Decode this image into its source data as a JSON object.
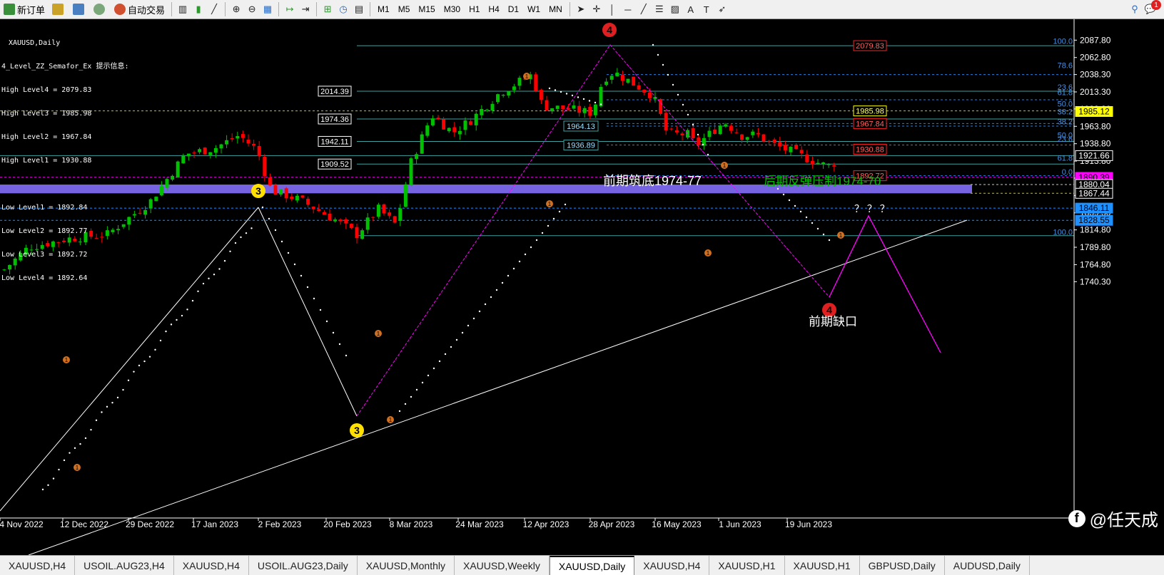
{
  "toolbar": {
    "new_order": "新订单",
    "auto_trade": "自动交易",
    "timeframes": [
      "M1",
      "M5",
      "M15",
      "M30",
      "H1",
      "H4",
      "D1",
      "W1",
      "MN"
    ],
    "alert_count": "1"
  },
  "chart": {
    "symbol_title": "XAUUSD,Daily",
    "indicator_title": "4_Level_ZZ_Semafor_Ex 提示信息:",
    "high_levels": [
      "High Level4 = 2079.83",
      "High Level3 = 1985.98",
      "High Level2 = 1967.84",
      "High Level1 = 1930.88"
    ],
    "low_levels": [
      "Low Level1 = 1892.84",
      "Low Level2 = 1892.77",
      "Low Level3 = 1892.72",
      "Low Level4 = 1892.64"
    ],
    "price_ticks": [
      "2087.80",
      "2062.80",
      "2038.30",
      "2013.30",
      "1988.80",
      "1963.80",
      "1938.80",
      "1913.80",
      "1889.30",
      "1864.30",
      "1839.30",
      "1814.80",
      "1789.80",
      "1764.80",
      "1740.30"
    ],
    "price_tags": [
      {
        "text": "1985.12",
        "bg": "#ffff00",
        "fg": "#000000"
      },
      {
        "text": "1921.66",
        "bg": "#000000",
        "fg": "#ffffff"
      },
      {
        "text": "1890.39",
        "bg": "#ff00ff",
        "fg": "#000000"
      },
      {
        "text": "1880.04",
        "bg": "#000000",
        "fg": "#ffffff"
      },
      {
        "text": "1867.44",
        "bg": "#000000",
        "fg": "#ffffff"
      },
      {
        "text": "1846.11",
        "bg": "#1e90ff",
        "fg": "#000000"
      },
      {
        "text": "1828.55",
        "bg": "#1e90ff",
        "fg": "#000000"
      }
    ],
    "date_ticks": [
      "4 Nov 2022",
      "12 Dec 2022",
      "29 Dec 2022",
      "17 Jan 2023",
      "2 Feb 2023",
      "20 Feb 2023",
      "8 Mar 2023",
      "24 Mar 2023",
      "12 Apr 2023",
      "28 Apr 2023",
      "16 May 2023",
      "1 Jun 2023",
      "19 Jun 2023"
    ],
    "fib_labels_upper": [
      "100.0",
      "78.6",
      "23.6",
      "61.8",
      "50.0",
      "38.2",
      "38.2",
      "50.0",
      "23.6",
      "61.8",
      "0.0"
    ],
    "fib_label_lower": "100.0",
    "level_boxes": [
      "2014.39",
      "1974.36",
      "1942.11",
      "1909.52"
    ],
    "zz_boxes": [
      "1964.13",
      "1936.89"
    ],
    "red_boxes": [
      "2079.83",
      "1967.84",
      "1930.88",
      "1892.72"
    ],
    "yellow_box": "1985.98",
    "annot_support": "前期筑底1974-77",
    "annot_resist": "后期反弹压制1974-70",
    "annot_gap": "前期缺口",
    "question_marks": "？ ？ ？",
    "wave_markers": [
      "3",
      "3",
      "4",
      "4"
    ],
    "small_markers": [
      "1",
      "1",
      "1",
      "1",
      "1",
      "1",
      "1",
      "1"
    ],
    "colors": {
      "bull": "#00c000",
      "bear": "#ff0000",
      "zigzag": "#ff00ff",
      "gap_band": "#7b68ee",
      "fib": "#2f7fd0",
      "teal": "#40a0a0"
    }
  },
  "tabs": [
    "XAUUSD,H4",
    "USOIL.AUG23,H4",
    "XAUUSD,H4",
    "USOIL.AUG23,Daily",
    "XAUUSD,Monthly",
    "XAUUSD,Weekly",
    "XAUUSD,Daily",
    "XAUUSD,H4",
    "XAUUSD,H1",
    "XAUUSD,H1",
    "GBPUSD,Daily",
    "AUDUSD,Daily"
  ],
  "active_tab": "XAUUSD,Daily",
  "watermark": "@任天成"
}
